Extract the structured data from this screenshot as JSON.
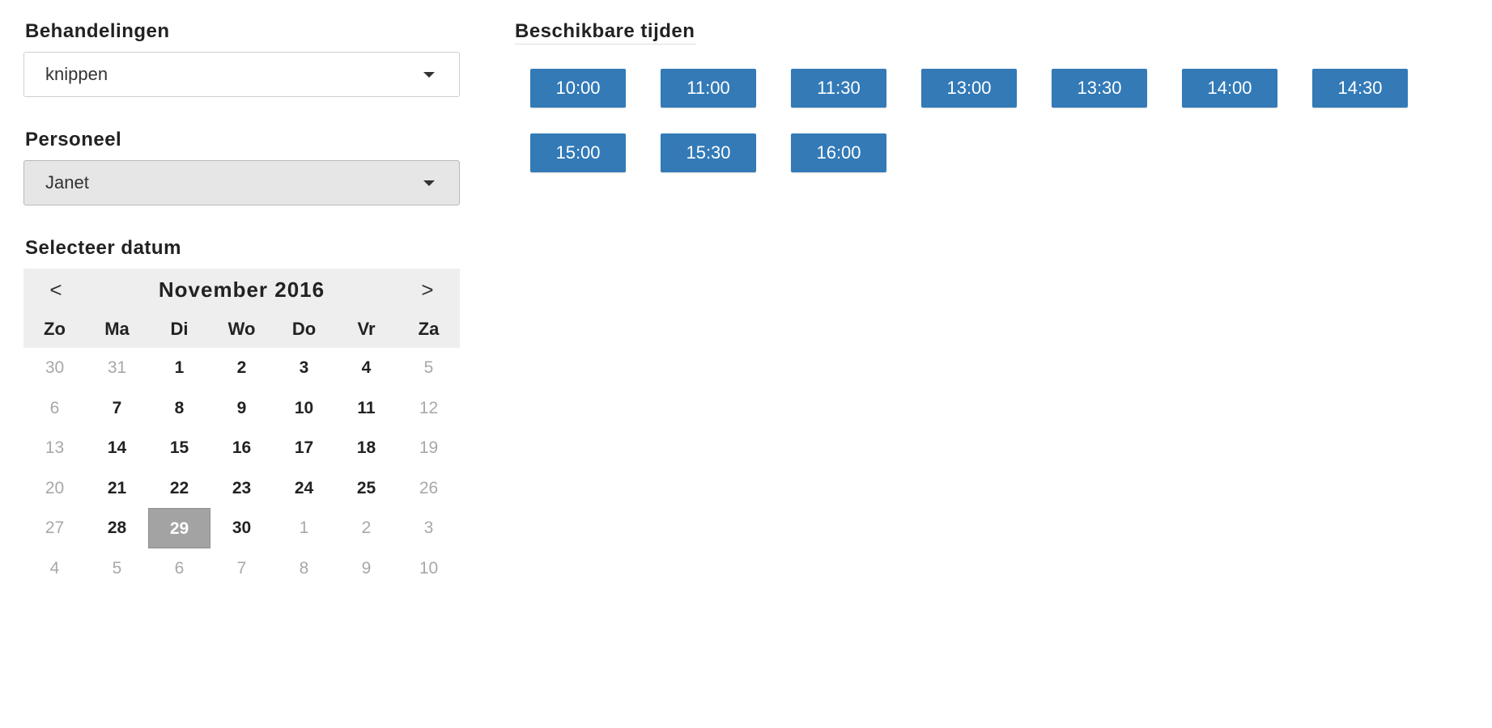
{
  "treatments": {
    "label": "Behandelingen",
    "selected": "knippen"
  },
  "staff": {
    "label": "Personeel",
    "selected": "Janet"
  },
  "date": {
    "label": "Selecteer datum",
    "month_title": "November 2016",
    "prev": "<",
    "next": ">",
    "weekdays": [
      "Zo",
      "Ma",
      "Di",
      "Wo",
      "Do",
      "Vr",
      "Za"
    ],
    "days": [
      {
        "d": "30",
        "muted": true
      },
      {
        "d": "31",
        "muted": true
      },
      {
        "d": "1"
      },
      {
        "d": "2"
      },
      {
        "d": "3"
      },
      {
        "d": "4"
      },
      {
        "d": "5",
        "muted": true
      },
      {
        "d": "6",
        "muted": true
      },
      {
        "d": "7"
      },
      {
        "d": "8"
      },
      {
        "d": "9"
      },
      {
        "d": "10"
      },
      {
        "d": "11"
      },
      {
        "d": "12",
        "muted": true
      },
      {
        "d": "13",
        "muted": true
      },
      {
        "d": "14"
      },
      {
        "d": "15"
      },
      {
        "d": "16"
      },
      {
        "d": "17"
      },
      {
        "d": "18"
      },
      {
        "d": "19",
        "muted": true
      },
      {
        "d": "20",
        "muted": true
      },
      {
        "d": "21"
      },
      {
        "d": "22"
      },
      {
        "d": "23"
      },
      {
        "d": "24"
      },
      {
        "d": "25"
      },
      {
        "d": "26",
        "muted": true
      },
      {
        "d": "27",
        "muted": true
      },
      {
        "d": "28"
      },
      {
        "d": "29",
        "selected": true
      },
      {
        "d": "30"
      },
      {
        "d": "1",
        "muted": true
      },
      {
        "d": "2",
        "muted": true
      },
      {
        "d": "3",
        "muted": true
      },
      {
        "d": "4",
        "muted": true
      },
      {
        "d": "5",
        "muted": true
      },
      {
        "d": "6",
        "muted": true
      },
      {
        "d": "7",
        "muted": true
      },
      {
        "d": "8",
        "muted": true
      },
      {
        "d": "9",
        "muted": true
      },
      {
        "d": "10",
        "muted": true
      }
    ]
  },
  "available_times": {
    "label": "Beschikbare tijden",
    "slots": [
      "10:00",
      "11:00",
      "11:30",
      "13:00",
      "13:30",
      "14:00",
      "14:30",
      "15:00",
      "15:30",
      "16:00"
    ]
  },
  "colors": {
    "slot_bg": "#337ab7",
    "selected_day_bg": "#a3a3a3",
    "header_bg": "#eeeeee"
  }
}
